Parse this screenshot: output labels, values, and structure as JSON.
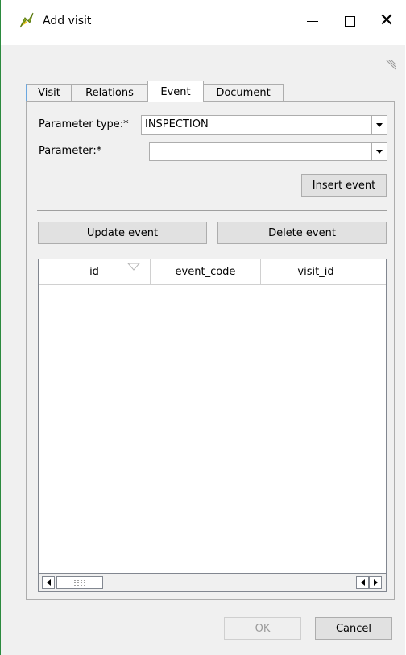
{
  "window": {
    "title": "Add visit",
    "icon": "qgis-logo-icon"
  },
  "tabs": [
    {
      "label": "Visit",
      "active": false
    },
    {
      "label": "Relations",
      "active": false
    },
    {
      "label": "Event",
      "active": true
    },
    {
      "label": "Document",
      "active": false
    }
  ],
  "form": {
    "parameter_type_label": "Parameter type:*",
    "parameter_type_value": "INSPECTION",
    "parameter_label": "Parameter:*",
    "parameter_value": "",
    "insert_event_label": "Insert event"
  },
  "actions": {
    "update_event_label": "Update event",
    "delete_event_label": "Delete event"
  },
  "table": {
    "columns": [
      "id",
      "event_code",
      "visit_id",
      ""
    ],
    "rows": []
  },
  "dialog_buttons": {
    "ok_label": "OK",
    "cancel_label": "Cancel"
  },
  "colors": {
    "accent_tab": "#6aa7e0",
    "window_border": "#2b8a3e"
  }
}
